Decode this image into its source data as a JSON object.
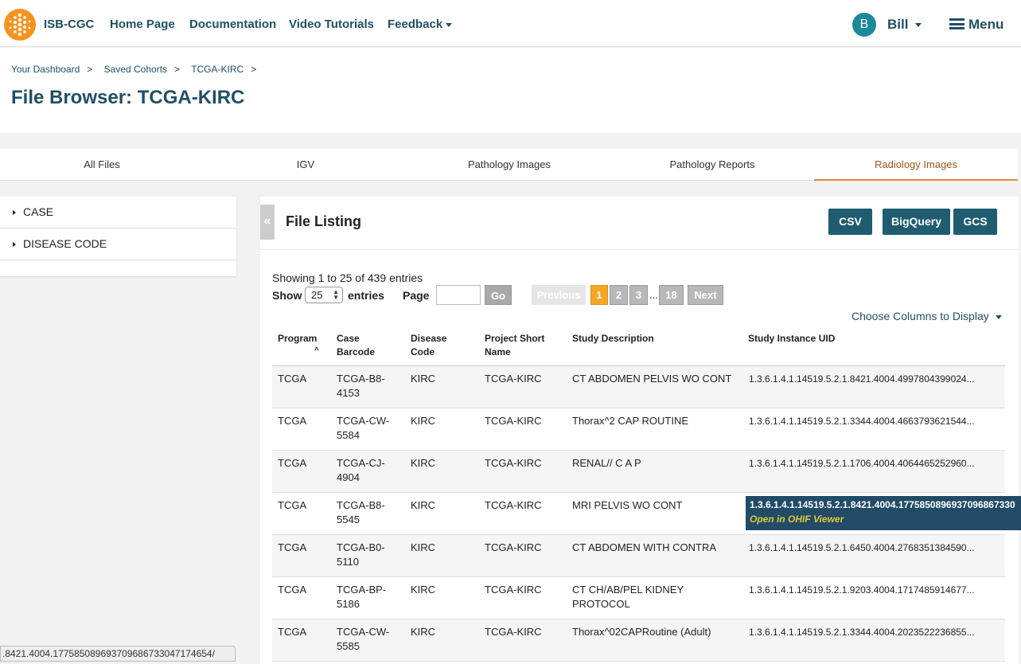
{
  "nav": {
    "brand": "ISB-CGC",
    "links": [
      "Home Page",
      "Documentation",
      "Video Tutorials",
      "Feedback"
    ],
    "avatar_initial": "B",
    "user": "Bill",
    "menu": "Menu"
  },
  "breadcrumb": [
    "Your Dashboard",
    "Saved Cohorts",
    "TCGA-KIRC"
  ],
  "breadcrumb_sep": ">",
  "page_title_prefix": "File Browser: ",
  "page_title_cohort": "TCGA-KIRC",
  "tabs": [
    "All Files",
    "IGV",
    "Pathology Images",
    "Pathology Reports",
    "Radiology Images"
  ],
  "active_tab": "Radiology Images",
  "sidebar": [
    "CASE",
    "DISEASE CODE"
  ],
  "file_listing": {
    "title": "File Listing",
    "collapse_icon": "«",
    "buttons": [
      "CSV",
      "BigQuery",
      "GCS"
    ],
    "showing": "Showing 1 to 25 of 439 entries",
    "show_label": "Show",
    "page_size": "25",
    "entries_label": "entries",
    "page_label": "Page",
    "page_input": "",
    "go": "Go",
    "prev": "Previous",
    "pages": [
      "1",
      "2",
      "3"
    ],
    "ellipsis": "...",
    "last_page": "18",
    "next": "Next",
    "choose_columns": "Choose Columns to Display"
  },
  "columns": {
    "program": "Program",
    "case_barcode": [
      "Case",
      "Barcode"
    ],
    "disease_code": [
      "Disease",
      "Code"
    ],
    "project_short_name": [
      "Project Short",
      "Name"
    ],
    "study_description": "Study Description",
    "study_uid": "Study Instance UID"
  },
  "rows": [
    {
      "program": "TCGA",
      "case": [
        "TCGA-B8-",
        "4153"
      ],
      "disease": "KIRC",
      "project": "TCGA-KIRC",
      "desc": [
        "CT ABDOMEN PELVIS WO CONT"
      ],
      "uid": "1.3.6.1.4.1.14519.5.2.1.8421.4004.4997804399024..."
    },
    {
      "program": "TCGA",
      "case": [
        "TCGA-CW-",
        "5584"
      ],
      "disease": "KIRC",
      "project": "TCGA-KIRC",
      "desc": [
        "Thorax^2 CAP ROUTINE"
      ],
      "uid": "1.3.6.1.4.1.14519.5.2.1.3344.4004.4663793621544..."
    },
    {
      "program": "TCGA",
      "case": [
        "TCGA-CJ-",
        "4904"
      ],
      "disease": "KIRC",
      "project": "TCGA-KIRC",
      "desc": [
        "RENAL// C A P"
      ],
      "uid": "1.3.6.1.4.1.14519.5.2.1.1706.4004.4064465252960..."
    },
    {
      "program": "TCGA",
      "case": [
        "TCGA-B8-",
        "5545"
      ],
      "disease": "KIRC",
      "project": "TCGA-KIRC",
      "desc": [
        "MRI PELVIS WO CONT"
      ],
      "uid": ""
    },
    {
      "program": "TCGA",
      "case": [
        "TCGA-B0-",
        "5110"
      ],
      "disease": "KIRC",
      "project": "TCGA-KIRC",
      "desc": [
        "CT ABDOMEN WITH CONTRA"
      ],
      "uid": "1.3.6.1.4.1.14519.5.2.1.6450.4004.2768351384590..."
    },
    {
      "program": "TCGA",
      "case": [
        "TCGA-BP-",
        "5186"
      ],
      "disease": "KIRC",
      "project": "TCGA-KIRC",
      "desc": [
        "CT CH/AB/PEL KIDNEY",
        "PROTOCOL"
      ],
      "uid": "1.3.6.1.4.1.14519.5.2.1.9203.4004.1717485914677..."
    },
    {
      "program": "TCGA",
      "case": [
        "TCGA-CW-",
        "5585"
      ],
      "disease": "KIRC",
      "project": "TCGA-KIRC",
      "desc": [
        "Thorax^02CAPRoutine (Adult)"
      ],
      "uid": "1.3.6.1.4.1.14519.5.2.1.3344.4004.2023522236855..."
    }
  ],
  "tooltip": {
    "uid": "1.3.6.1.4.1.14519.5.2.1.8421.4004.1775850896937096867330",
    "link": "Open in OHIF Viewer"
  },
  "status_url": ".8421.4004.177585089693709686733047174654/",
  "colors": {
    "brand": "#1f4f66",
    "accent": "#f7931e",
    "button": "#1f5c70",
    "active_page": "#f5a623"
  }
}
